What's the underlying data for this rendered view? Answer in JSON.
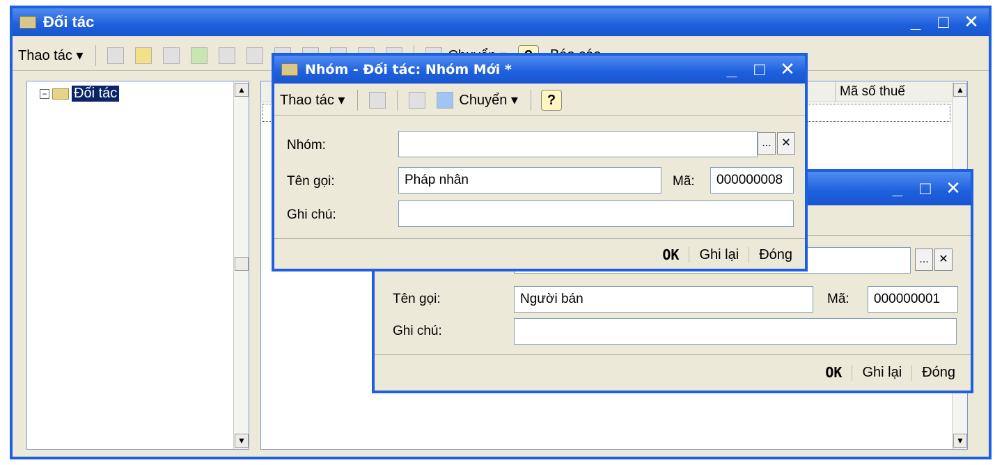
{
  "main_window": {
    "title": "Đối tác",
    "toolbar": {
      "actions_label": "Thao tác ▾",
      "move_label": "Chuyển ▾",
      "report_label": "Báo cáo"
    },
    "tree": {
      "root_label": "Đối tác"
    },
    "list": {
      "columns": [
        "",
        "Mã số thuế"
      ]
    }
  },
  "window_controls": {
    "minimize": "_",
    "maximize": "□",
    "close": "✕"
  },
  "dialog_front": {
    "title": "Nhóm - Đối tác: Nhóm Mới *",
    "toolbar": {
      "actions_label": "Thao tác ▾",
      "move_label": "Chuyển ▾",
      "help": "?"
    },
    "fields": {
      "group_label": "Nhóm:",
      "group_value": "",
      "name_label": "Tên gọi:",
      "name_value": "Pháp nhân",
      "code_label": "Mã:",
      "code_value": "000000008",
      "note_label": "Ghi chú:",
      "note_value": ""
    },
    "buttons": {
      "ok": "OK",
      "save": "Ghi lại",
      "close": "Đóng"
    }
  },
  "dialog_back": {
    "fields": {
      "name_label": "Tên gọi:",
      "name_value": "Người bán",
      "code_label": "Mã:",
      "code_value": "000000001",
      "note_label": "Ghi chú:",
      "note_value": ""
    },
    "buttons": {
      "ok": "OK",
      "save": "Ghi lại",
      "close": "Đóng"
    }
  },
  "small_buttons": {
    "select": "...",
    "clear": "✕"
  },
  "colors": {
    "title_bar": "#1d5fdc",
    "window_bg": "#ece9d8",
    "selection": "#0a246a"
  }
}
